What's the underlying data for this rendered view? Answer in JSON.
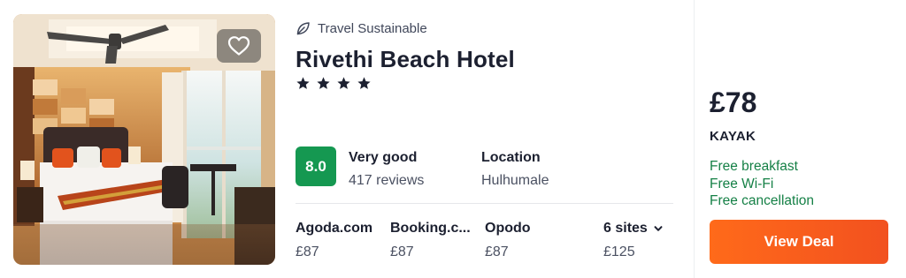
{
  "listing": {
    "badge": "Travel Sustainable",
    "name": "Rivethi Beach Hotel",
    "star_count": 4,
    "rating": {
      "score": "8.0",
      "label": "Very good",
      "reviews": "417 reviews"
    },
    "location": {
      "label": "Location",
      "value": "Hulhumale"
    },
    "providers": [
      {
        "name": "Agoda.com",
        "price": "£87"
      },
      {
        "name": "Booking.c...",
        "price": "£87"
      },
      {
        "name": "Opodo",
        "price": "£87"
      }
    ],
    "more_sites": {
      "label": "6 sites",
      "price": "£125"
    },
    "best_deal": {
      "price": "£78",
      "vendor": "KAYAK",
      "perks": [
        "Free breakfast",
        "Free Wi-Fi",
        "Free cancellation"
      ],
      "button_label": "View Deal"
    }
  },
  "colors": {
    "score_badge": "#159851",
    "perk_text": "#158046",
    "deal_button": "#ff690f"
  },
  "icons": {
    "favorite": "heart-icon",
    "sustainable": "leaf-icon",
    "star": "star-icon",
    "more_sites": "chevron-down-icon"
  }
}
